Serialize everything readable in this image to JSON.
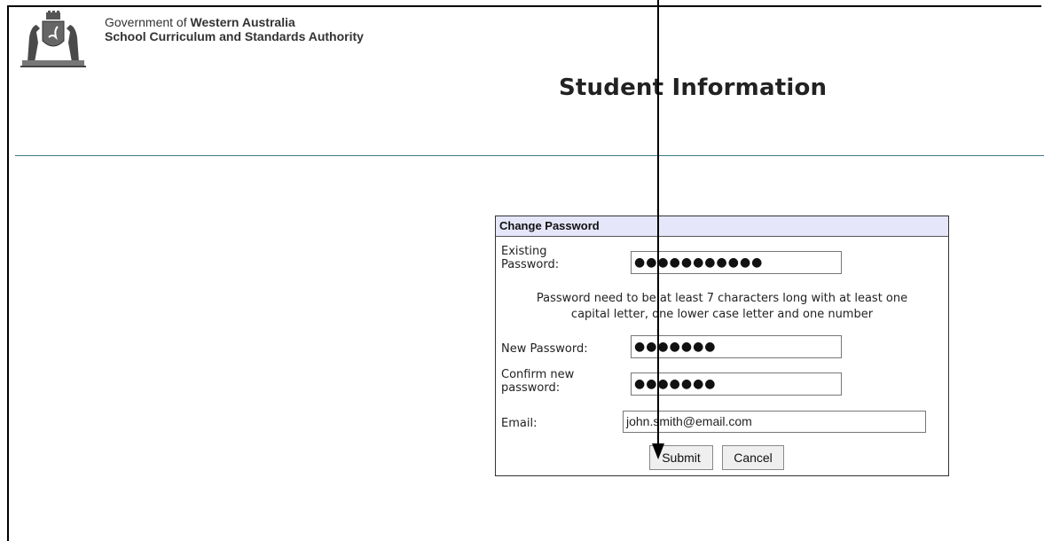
{
  "header": {
    "gov_prefix": "Government of ",
    "gov_bold": "Western Australia",
    "authority": "School Curriculum and Standards Authority"
  },
  "page": {
    "title": "Student Information"
  },
  "change_password": {
    "panel_title": "Change Password",
    "existing_label_line1": "Existing",
    "existing_label_line2": "Password:",
    "existing_value": "●●●●●●●●●●●",
    "hint_line1": "Password need to be at least 7 characters long with at least one",
    "hint_line2": "capital letter, one lower case letter and one number",
    "new_label": "New Password:",
    "new_value": "●●●●●●●",
    "confirm_label_line1": "Confirm new",
    "confirm_label_line2": "password:",
    "confirm_value": "●●●●●●●",
    "email_label": "Email:",
    "email_value": "john.smith@email.com",
    "submit_label": "Submit",
    "cancel_label": "Cancel"
  },
  "colors": {
    "panel_header_bg": "#e6e6fa",
    "divider": "#3b7a88"
  },
  "icons": {
    "logo": "wa-government-crest-icon",
    "pointer": "arrow-down-icon"
  }
}
